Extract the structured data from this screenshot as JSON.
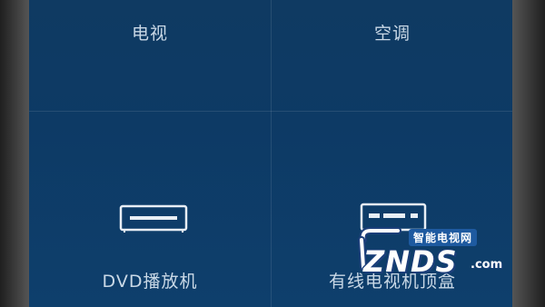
{
  "devices": {
    "tv": {
      "label": "电视",
      "icon": "tv-icon"
    },
    "ac": {
      "label": "空调",
      "icon": "air-conditioner-icon"
    },
    "dvd": {
      "label": "DVD播放机",
      "icon": "dvd-player-icon"
    },
    "stb": {
      "label": "有线电视机顶盒",
      "icon": "set-top-box-icon"
    }
  },
  "watermark": {
    "chinese": "智能电视网",
    "main": "ZNDS",
    "suffix": ".com"
  },
  "colors": {
    "background": "#0d3a65",
    "label": "#c9d8e6",
    "icon_stroke": "#e8eef5"
  }
}
